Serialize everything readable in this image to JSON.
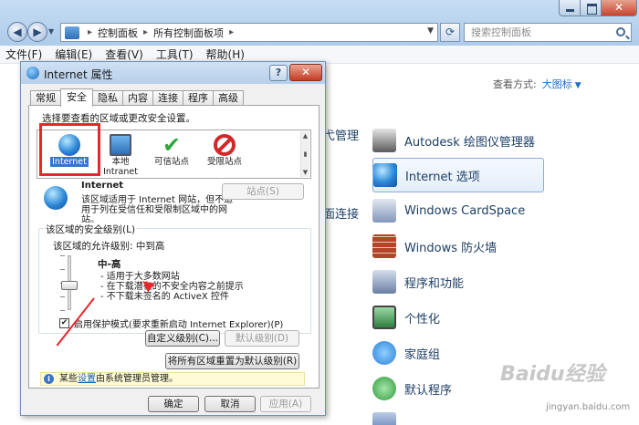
{
  "explorer": {
    "breadcrumb": [
      "控制面板",
      "所有控制面板项"
    ],
    "search_placeholder": "搜索控制面板",
    "menu": [
      "文件(F)",
      "编辑(E)",
      "查看(V)",
      "工具(T)",
      "帮助(H)"
    ],
    "view_by_label": "查看方式:",
    "view_by_value": "大图标",
    "items": [
      {
        "label": "Autodesk 绘图仪管理器",
        "icon": "plotter-icon",
        "color": "#3a3a3a"
      },
      {
        "label": "Internet 选项",
        "icon": "internet-options-icon",
        "color": "#2a86d6",
        "selected": true
      },
      {
        "label": "Windows CardSpace",
        "icon": "cardspace-icon",
        "color": "#7a8fb8"
      },
      {
        "label": "Windows 防火墙",
        "icon": "firewall-icon",
        "color": "#b4442a"
      },
      {
        "label": "程序和功能",
        "icon": "programs-icon",
        "color": "#6b7fa5"
      },
      {
        "label": "个性化",
        "icon": "personalization-icon",
        "color": "#3b8f4a"
      },
      {
        "label": "家庭组",
        "icon": "homegroup-icon",
        "color": "#2a7fd6"
      },
      {
        "label": "默认程序",
        "icon": "default-programs-icon",
        "color": "#2f9a3e"
      },
      {
        "label": "",
        "icon": "generic-icon",
        "color": "#4b6fa8"
      }
    ],
    "left_partial": [
      "弋管理",
      "面连接"
    ]
  },
  "dialog": {
    "title": "Internet 属性",
    "tabs": [
      "常规",
      "安全",
      "隐私",
      "内容",
      "连接",
      "程序",
      "高级"
    ],
    "active_tab": "安全",
    "instruction": "选择要查看的区域或更改安全设置。",
    "zones": [
      {
        "label": "Internet",
        "icon": "globe-icon",
        "selected": true
      },
      {
        "label": "本地 Intranet",
        "icon": "intranet-icon"
      },
      {
        "label": "可信站点",
        "icon": "trusted-check-icon"
      },
      {
        "label": "受限站点",
        "icon": "restricted-icon"
      }
    ],
    "zone_title": "Internet",
    "zone_desc": "该区域适用于 Internet 网站，但不适用于列在受信任和受限制区域中的网站。",
    "sites_button": "站点(S)",
    "security_group": "该区域的安全级别(L)",
    "allowed_levels": "该区域的允许级别: 中到高",
    "level_name": "中-高",
    "level_desc": [
      "- 适用于大多数网站",
      "- 在下载潜在的不安全内容之前提示",
      "- 不下载未签名的 ActiveX 控件"
    ],
    "protected_mode": "启用保护模式(要求重新启动 Internet Explorer)(P)",
    "protected_mode_checked": true,
    "custom_level": "自定义级别(C)...",
    "default_level": "默认级别(D)",
    "reset_all": "将所有区域重置为默认级别(R)",
    "info_prefix": "某些",
    "info_link": "设置",
    "info_suffix": "由系统管理员管理。",
    "ok": "确定",
    "cancel": "取消",
    "apply": "应用(A)"
  },
  "watermark": {
    "brand": "Baidu经验",
    "url": "jingyan.baidu.com"
  },
  "colors": {
    "highlight": "#e8262c",
    "selection": "#3874d1",
    "link": "#1f6fc4"
  }
}
